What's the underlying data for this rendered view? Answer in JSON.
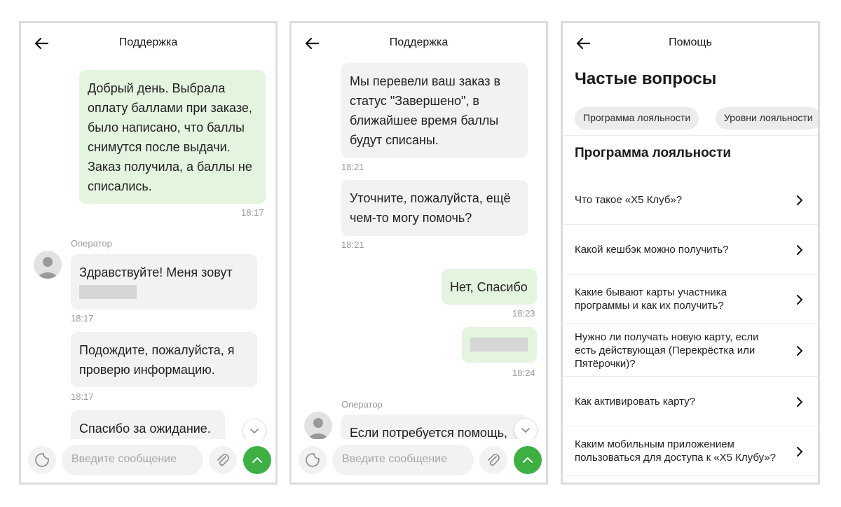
{
  "chat1": {
    "title": "Поддержка",
    "msg_user": "Добрый день. Выбрала оплату баллами при заказе, было написано, что баллы снимутся после выдачи. Заказ получила, а баллы не списались.",
    "time_user": "18:17",
    "operator_label": "Оператор",
    "msg_op1": "Здравствуйте! Меня зовут",
    "time_op1": "18:17",
    "msg_op2": "Подождите, пожалуйста, я проверю информацию.",
    "time_op2": "18:17",
    "msg_op3": "Спасибо за ожидание.",
    "input_placeholder": "Введите сообщение"
  },
  "chat2": {
    "title": "Поддержка",
    "msg_op1": "Мы перевели ваш заказ в статус \"Завершено\", в ближайшее время баллы будут списаны.",
    "time_op1": "18:21",
    "msg_op2": "Уточните, пожалуйста, ещё чем-то могу помочь?",
    "time_op2": "18:21",
    "msg_user1": "Нет, Спасибо",
    "time_user1": "18:23",
    "time_user2": "18:24",
    "operator_label": "Оператор",
    "msg_op3": "Если потребуется помощь,",
    "input_placeholder": "Введите сообщение"
  },
  "help": {
    "title": "Помощь",
    "heading": "Частые вопросы",
    "chips": [
      "Программа лояльности",
      "Уровни лояльности"
    ],
    "section": "Программа лояльности",
    "items": [
      "Что такое «X5 Клуб»?",
      "Какой кешбэк можно получить?",
      "Какие бывают карты участника программы и как их получить?",
      "Нужно ли получать новую карту, если есть действующая (Перекрёстка или Пятёрочки)?",
      "Как активировать карту?",
      "Каким мобильным приложением пользоваться для доступа к «X5 Клубу»?"
    ]
  },
  "colors": {
    "accent": "#3cb043",
    "out_bubble": "#e3f4df",
    "in_bubble": "#f1f2f1"
  },
  "icons": [
    "arrow-left-icon",
    "sticker-icon",
    "paperclip-icon",
    "arrow-up-icon",
    "chevron-down-icon",
    "chevron-right-icon",
    "user-avatar-icon"
  ]
}
